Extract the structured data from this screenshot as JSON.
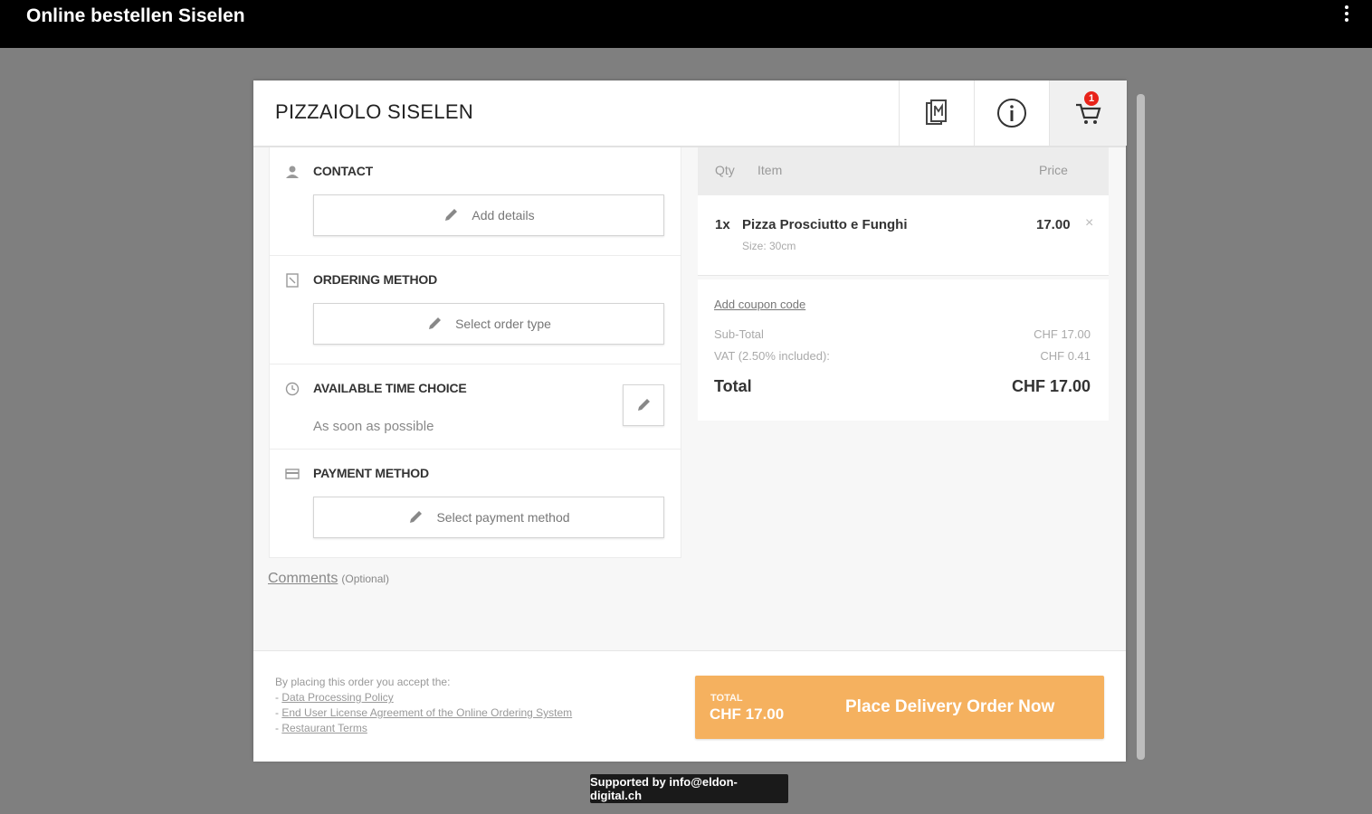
{
  "topbar": {
    "title": "Online bestellen Siselen"
  },
  "header": {
    "restaurant_name": "PIZZAIOLO SISELEN",
    "cart_count": "1"
  },
  "sections": {
    "contact": {
      "title": "CONTACT",
      "button": "Add details"
    },
    "ordering": {
      "title": "ORDERING METHOD",
      "button": "Select order type"
    },
    "time": {
      "title": "AVAILABLE TIME CHOICE",
      "value": "As soon as possible"
    },
    "payment": {
      "title": "PAYMENT METHOD",
      "button": "Select payment method"
    }
  },
  "comments": {
    "label": "Comments",
    "optional": "(Optional)"
  },
  "cart": {
    "columns": {
      "qty": "Qty",
      "item": "Item",
      "price": "Price"
    },
    "items": [
      {
        "qty": "1x",
        "name": "Pizza Prosciutto e Funghi",
        "size": "Size: 30cm",
        "price": "17.00"
      }
    ],
    "coupon": "Add coupon code",
    "subtotal_label": "Sub-Total",
    "subtotal_value": "CHF 17.00",
    "vat_label": "VAT (2.50% included):",
    "vat_value": "CHF 0.41",
    "total_label": "Total",
    "total_value": "CHF 17.00"
  },
  "footer": {
    "accept_text": "By placing this order you accept the:",
    "links": [
      "Data Processing Policy",
      "End User License Agreement of the Online Ordering System",
      "Restaurant Terms"
    ],
    "order_total_label": "TOTAL",
    "order_total_value": "CHF 17.00",
    "order_button": "Place Delivery Order Now"
  },
  "supported_by": "Supported by info@eldon-digital.ch",
  "colors": {
    "accent": "#f5b15f",
    "badge": "#e8231a",
    "topbar": "#000000",
    "backdrop": "#7f7f7f"
  }
}
